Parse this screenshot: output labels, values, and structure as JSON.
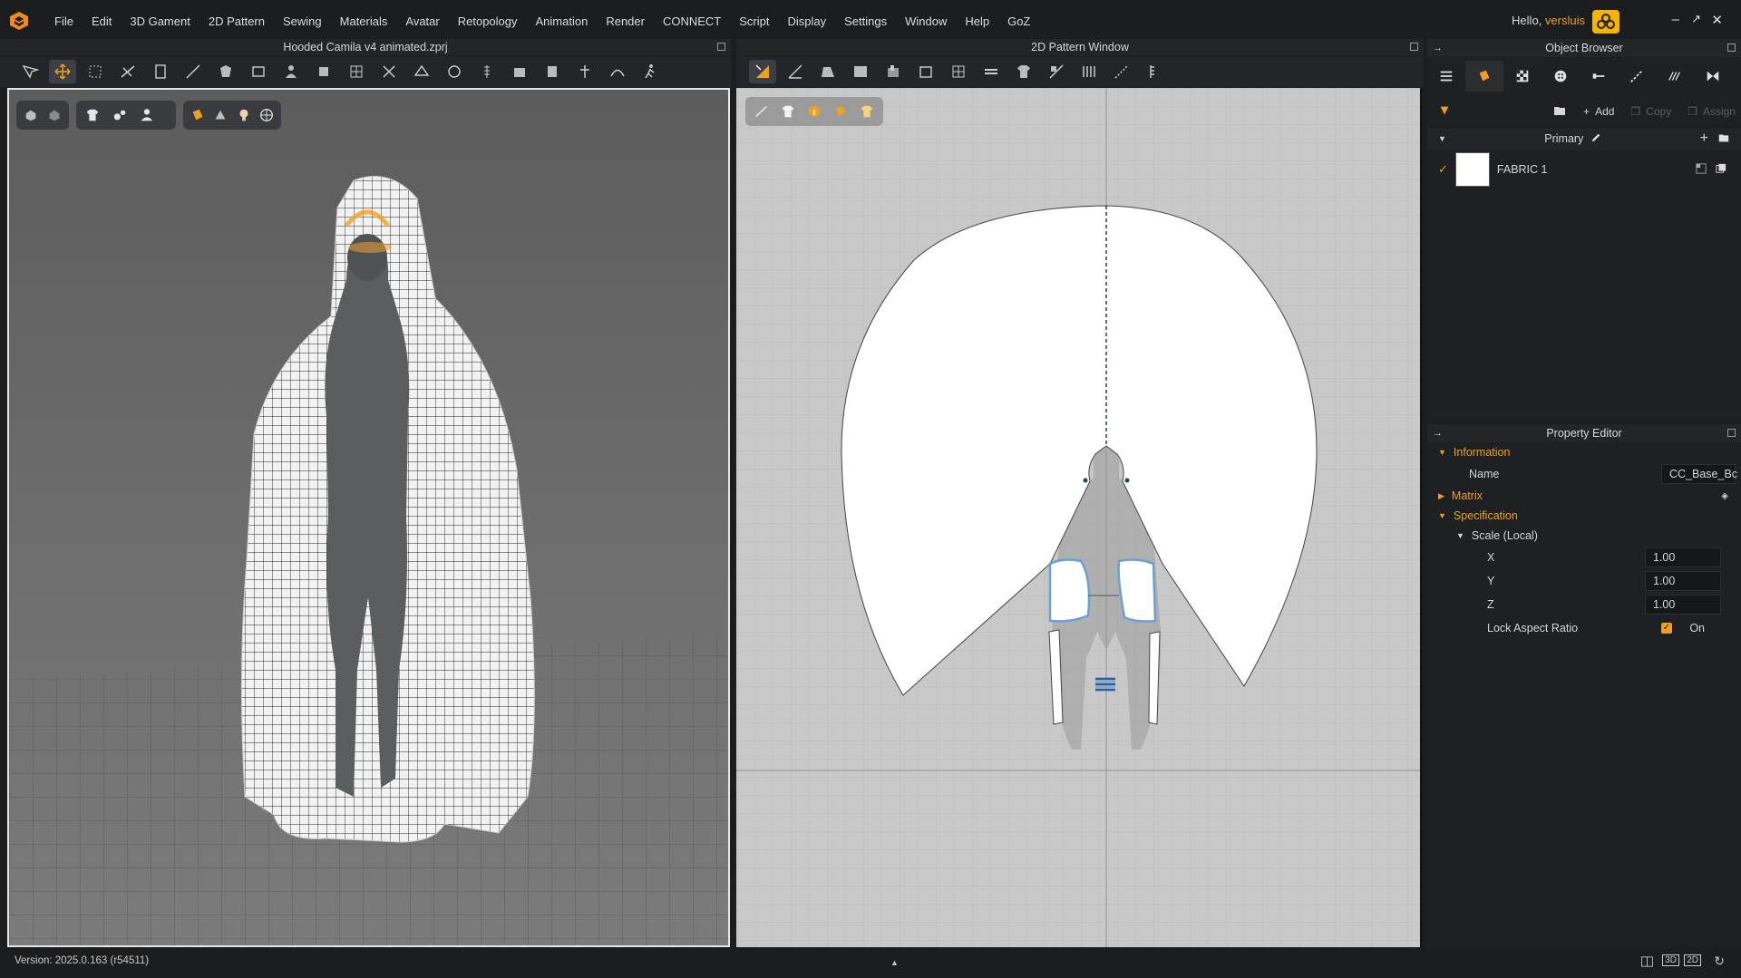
{
  "menubar": {
    "items": [
      "File",
      "Edit",
      "3D Gament",
      "2D Pattern",
      "Sewing",
      "Materials",
      "Avatar",
      "Retopology",
      "Animation",
      "Render",
      "CONNECT",
      "Script",
      "Display",
      "Settings",
      "Window",
      "Help",
      "GoZ"
    ],
    "greeting": "Hello,",
    "username": "versluis"
  },
  "viewport3d": {
    "title": "Hooded Camila v4 animated.zprj"
  },
  "pattern2d": {
    "title": "2D Pattern Window"
  },
  "object_browser": {
    "title": "Object Browser",
    "tabs": [
      "list-icon",
      "fabric-icon",
      "checker-icon",
      "button-icon",
      "zipper-icon",
      "topstitch-icon",
      "puckering-icon",
      "trim-icon"
    ],
    "actions": {
      "add": "Add",
      "copy": "Copy",
      "assign": "Assign"
    },
    "group": "Primary",
    "fabrics": [
      {
        "name": "FABRIC 1",
        "checked": true,
        "color": "#ffffff"
      }
    ]
  },
  "property_editor": {
    "title": "Property Editor",
    "information": {
      "label": "Information",
      "name_label": "Name",
      "name_value": "CC_Base_Bc"
    },
    "matrix": {
      "label": "Matrix"
    },
    "specification": {
      "label": "Specification",
      "scale_label": "Scale (Local)",
      "x_label": "X",
      "x_value": "1.00",
      "y_label": "Y",
      "y_value": "1.00",
      "z_label": "Z",
      "z_value": "1.00",
      "lock_label": "Lock Aspect Ratio",
      "lock_value": "On"
    }
  },
  "statusbar": {
    "version": "Version: 2025.0.163 (r54511)",
    "view_modes": [
      "split-view-icon",
      "3D",
      "2D",
      "refresh-icon"
    ]
  },
  "colors": {
    "accent": "#f0a020",
    "background": "#1c1d1f",
    "viewport3d_bg": "#6a6a6a",
    "pattern_bg": "#c8c8c8"
  }
}
